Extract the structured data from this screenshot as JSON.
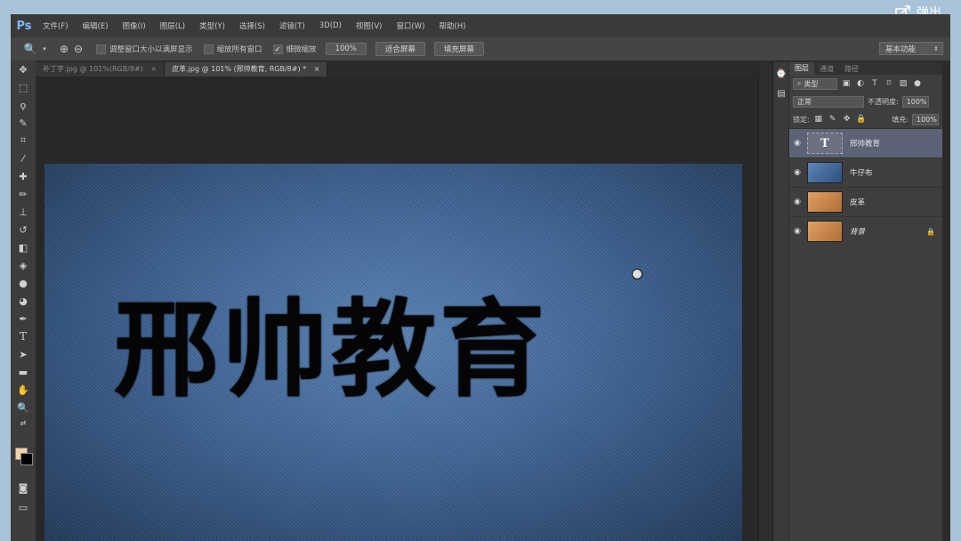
{
  "overlay": {
    "popout_label": "弹出"
  },
  "app": {
    "logo": "Ps"
  },
  "menu": [
    "文件(F)",
    "编辑(E)",
    "图像(I)",
    "图层(L)",
    "类型(Y)",
    "选择(S)",
    "滤镜(T)",
    "3D(D)",
    "视图(V)",
    "窗口(W)",
    "帮助(H)"
  ],
  "options": {
    "resize_windows": {
      "label": "调整窗口大小以满屏显示",
      "checked": false
    },
    "zoom_all": {
      "label": "缩放所有窗口",
      "checked": false
    },
    "scrubby_zoom": {
      "label": "细微缩放",
      "checked": true
    },
    "zoom_100": "100%",
    "fit_screen": "适合屏幕",
    "fill_screen": "填充屏幕",
    "workspace": "基本功能"
  },
  "tabs": [
    {
      "label": "补丁字.jpg @ 101%(RGB/8#)",
      "active": false
    },
    {
      "label": "皮革.jpg @ 101% (邢帅教育, RGB/8#) *",
      "active": true
    }
  ],
  "canvas": {
    "text": "邢帅教育"
  },
  "layers_panel": {
    "tabs": [
      "图层",
      "通道",
      "路径"
    ],
    "filter_kind": "类型",
    "blend_mode": "正常",
    "opacity_label": "不透明度:",
    "opacity": "100%",
    "lock_label": "锁定:",
    "fill_label": "填充:",
    "fill": "100%",
    "layers": [
      {
        "name": "邢帅教育",
        "kind": "text",
        "thumb_glyph": "T",
        "active": true,
        "locked": false
      },
      {
        "name": "牛仔布",
        "kind": "denim",
        "active": false,
        "locked": false
      },
      {
        "name": "皮革",
        "kind": "leather",
        "active": false,
        "locked": false
      },
      {
        "name": "背景",
        "kind": "leather",
        "active": false,
        "locked": true
      }
    ]
  },
  "colors": {
    "foreground": "#f2d2a8",
    "background": "#000000",
    "canvas": "#3c5f8a"
  }
}
